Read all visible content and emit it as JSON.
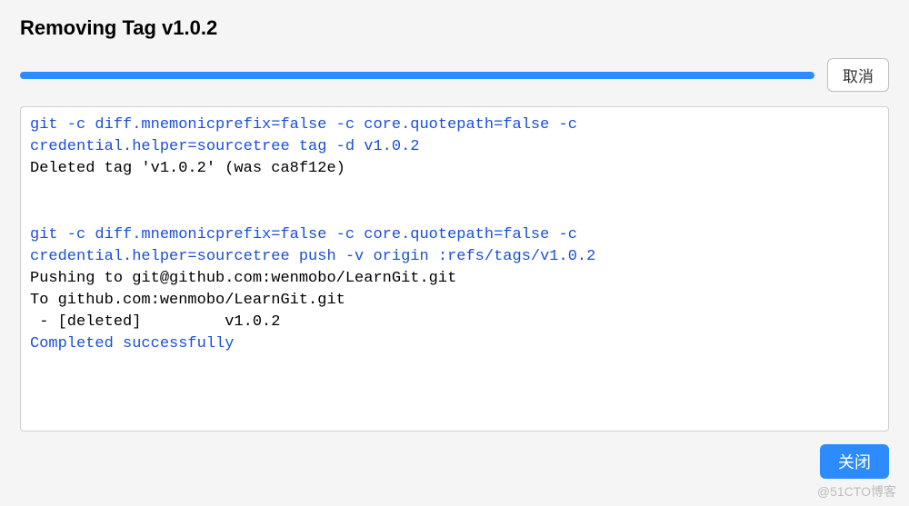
{
  "dialog": {
    "title": "Removing Tag v1.0.2",
    "cancel_label": "取消",
    "close_label": "关闭"
  },
  "output": {
    "lines": [
      {
        "cls": "cmd",
        "text": "git -c diff.mnemonicprefix=false -c core.quotepath=false -c "
      },
      {
        "cls": "cmd",
        "text": "credential.helper=sourcetree tag -d v1.0.2"
      },
      {
        "cls": "plain",
        "text": "Deleted tag 'v1.0.2' (was ca8f12e)"
      },
      {
        "cls": "plain",
        "text": ""
      },
      {
        "cls": "plain",
        "text": ""
      },
      {
        "cls": "cmd",
        "text": "git -c diff.mnemonicprefix=false -c core.quotepath=false -c "
      },
      {
        "cls": "cmd",
        "text": "credential.helper=sourcetree push -v origin :refs/tags/v1.0.2"
      },
      {
        "cls": "plain",
        "text": "Pushing to git@github.com:wenmobo/LearnGit.git"
      },
      {
        "cls": "plain",
        "text": "To github.com:wenmobo/LearnGit.git"
      },
      {
        "cls": "plain",
        "text": " - [deleted]         v1.0.2"
      },
      {
        "cls": "success",
        "text": "Completed successfully"
      }
    ]
  },
  "watermark": "@51CTO博客"
}
